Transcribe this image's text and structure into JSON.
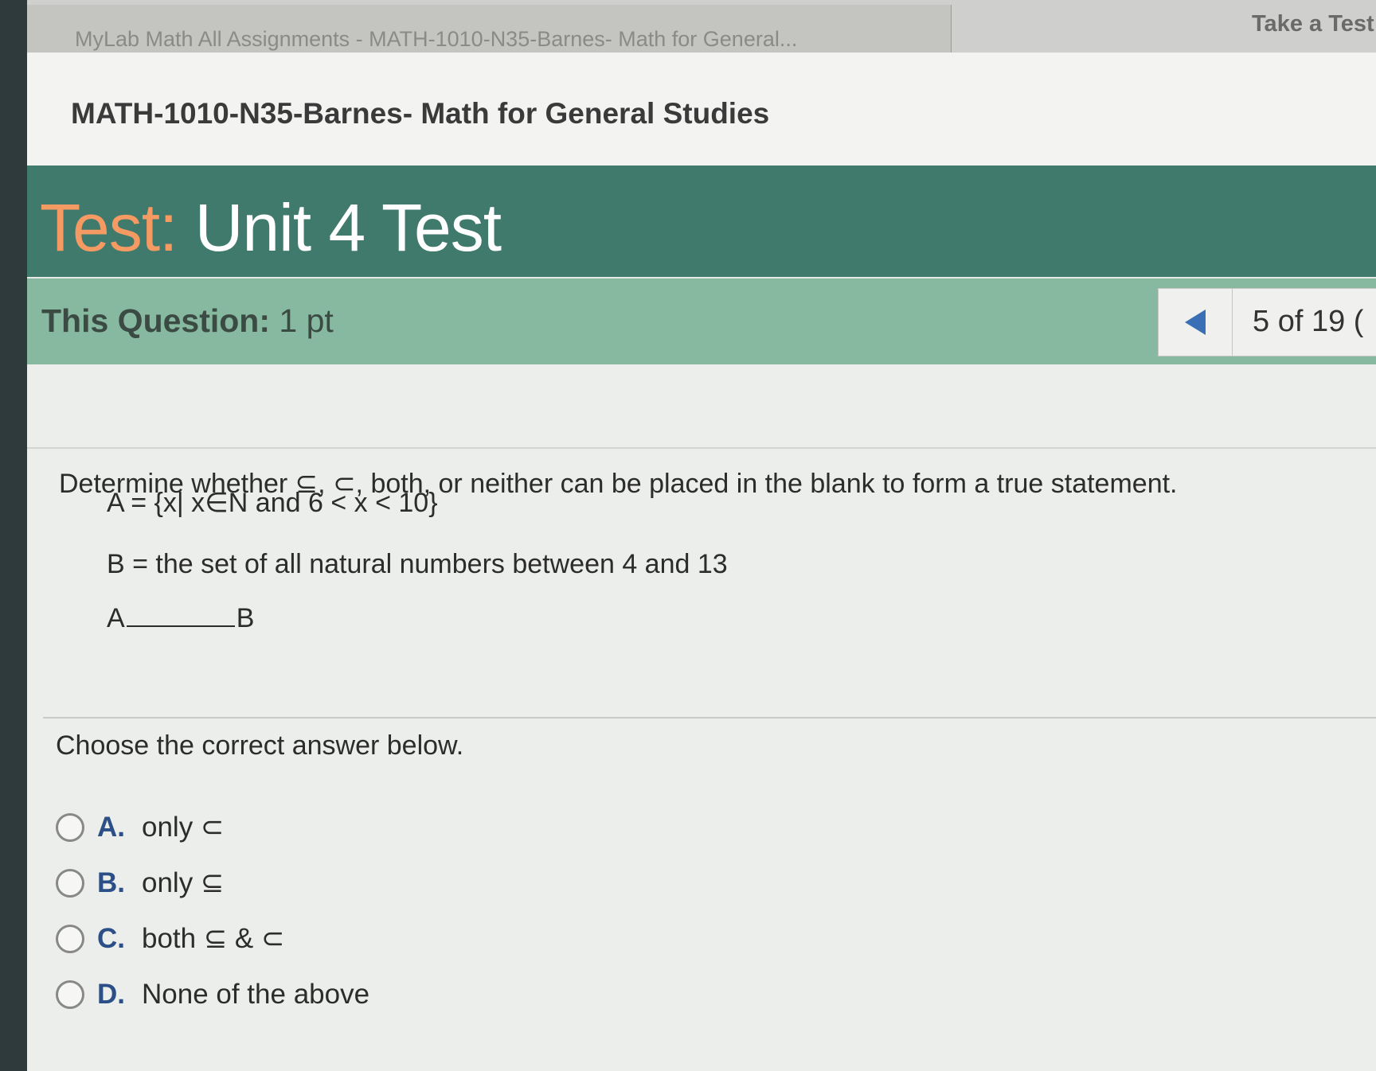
{
  "browser": {
    "tab_title": "MyLab Math All Assignments - MATH-1010-N35-Barnes- Math for General...",
    "tab_right_label": "Take a Test"
  },
  "course": {
    "title": "MATH-1010-N35-Barnes- Math for General Studies"
  },
  "test": {
    "label": "Test:",
    "name": "Unit 4 Test"
  },
  "question_bar": {
    "points_label": "This Question:",
    "points_value": "1 pt",
    "counter": "5 of 19 ("
  },
  "question": {
    "prompt": "Determine whether ⊆, ⊂, both, or neither can be placed in the blank to form a true statement.",
    "set_a": "A = {x|  x∈N and 6 < x < 10}",
    "set_b": "B = the set of all natural numbers between 4 and 13",
    "blank_left": "A",
    "blank_right": "B",
    "choose_text": "Choose the correct answer below."
  },
  "options": [
    {
      "letter": "A.",
      "text": "only ⊂"
    },
    {
      "letter": "B.",
      "text": "only ⊆"
    },
    {
      "letter": "C.",
      "text": "both ⊆ & ⊂"
    },
    {
      "letter": "D.",
      "text": "None of the above"
    }
  ]
}
